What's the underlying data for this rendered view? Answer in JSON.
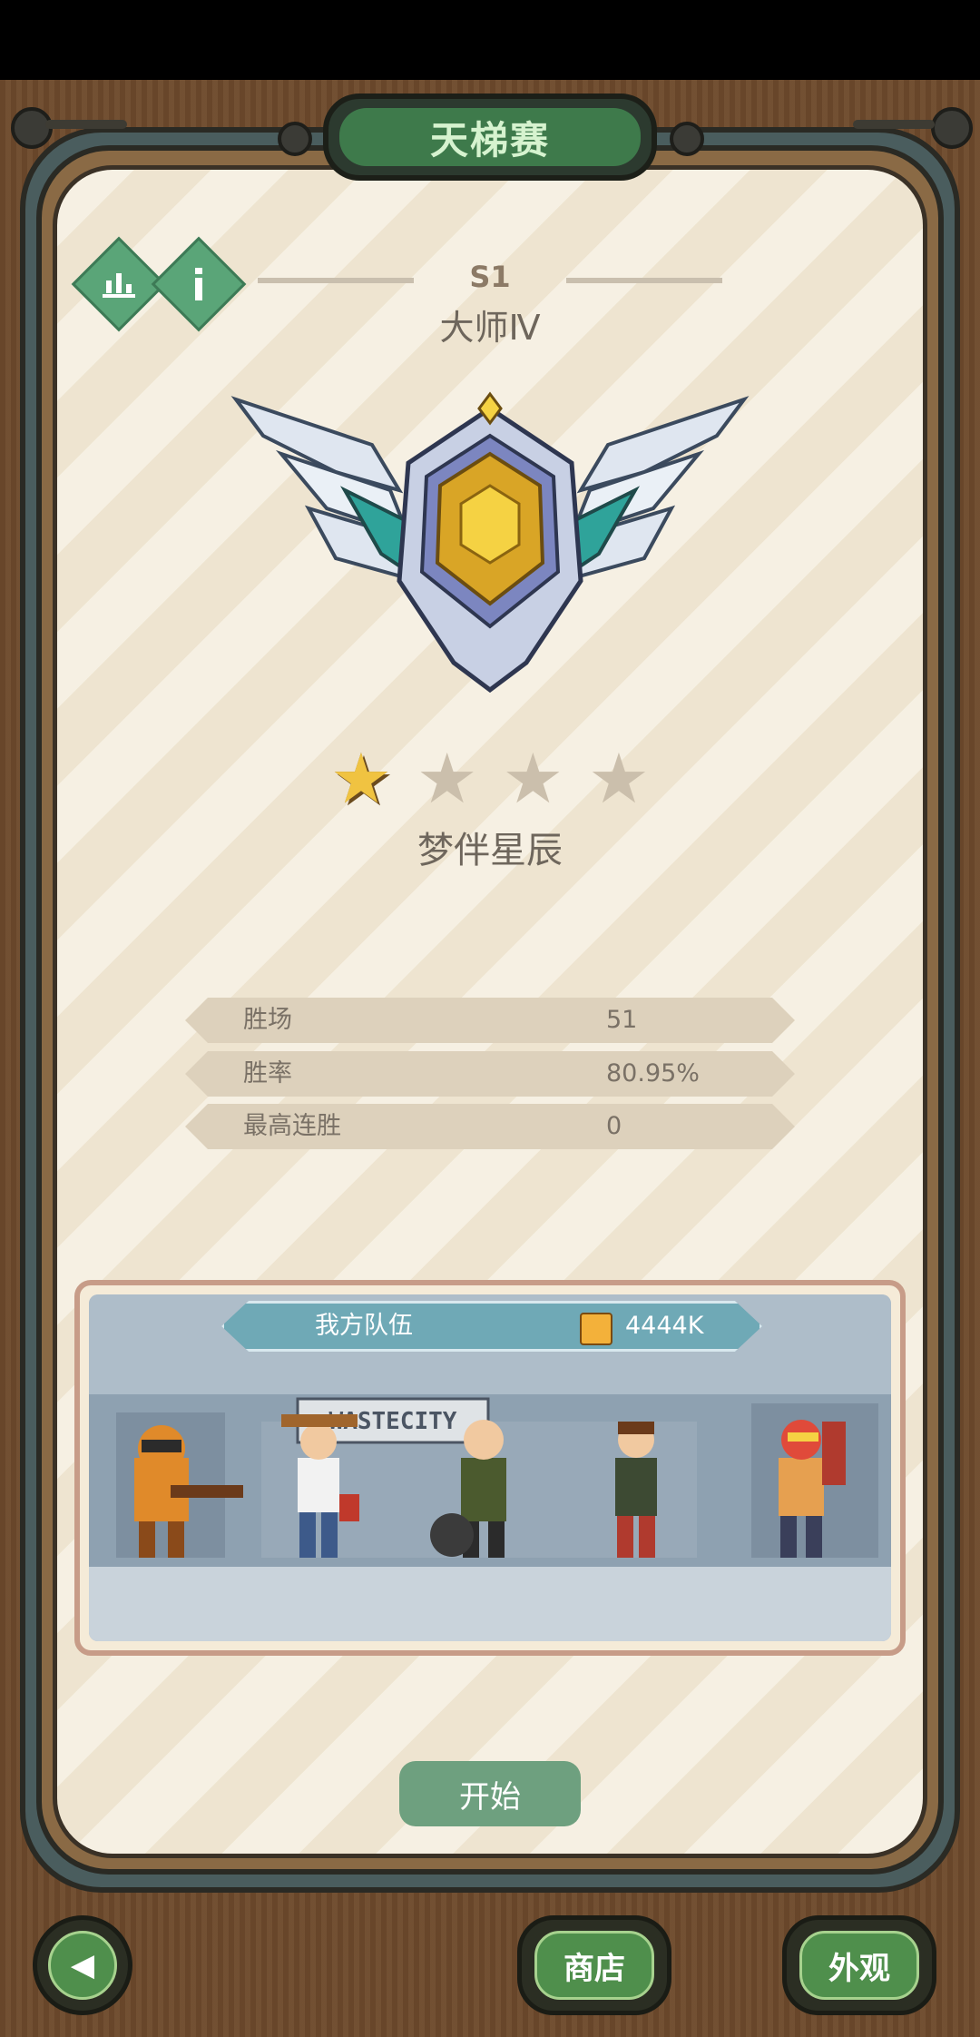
{
  "header": {
    "title": "天梯赛"
  },
  "season": {
    "label": "S1",
    "rank": "大师Ⅳ"
  },
  "stars": {
    "filled": 1,
    "total": 4,
    "rank_title": "梦伴星辰"
  },
  "stats": [
    {
      "label": "胜场",
      "value": "51"
    },
    {
      "label": "胜率",
      "value": "80.95%"
    },
    {
      "label": "最高连胜",
      "value": "0"
    }
  ],
  "team": {
    "label": "我方队伍",
    "power": "4444K",
    "sign_text": "WASTECITY"
  },
  "actions": {
    "start": "开始",
    "shop": "商店",
    "appearance": "外观",
    "back_icon": "◀"
  },
  "icons": {
    "leaderboard": "leaderboard-icon",
    "info": "info-icon",
    "star": "star-icon",
    "power": "fist-icon"
  },
  "colors": {
    "accent_green": "#5aa578",
    "button_green": "#4f8f4c",
    "star_gold": "#f0c341",
    "team_bar": "#6fa9b6"
  }
}
